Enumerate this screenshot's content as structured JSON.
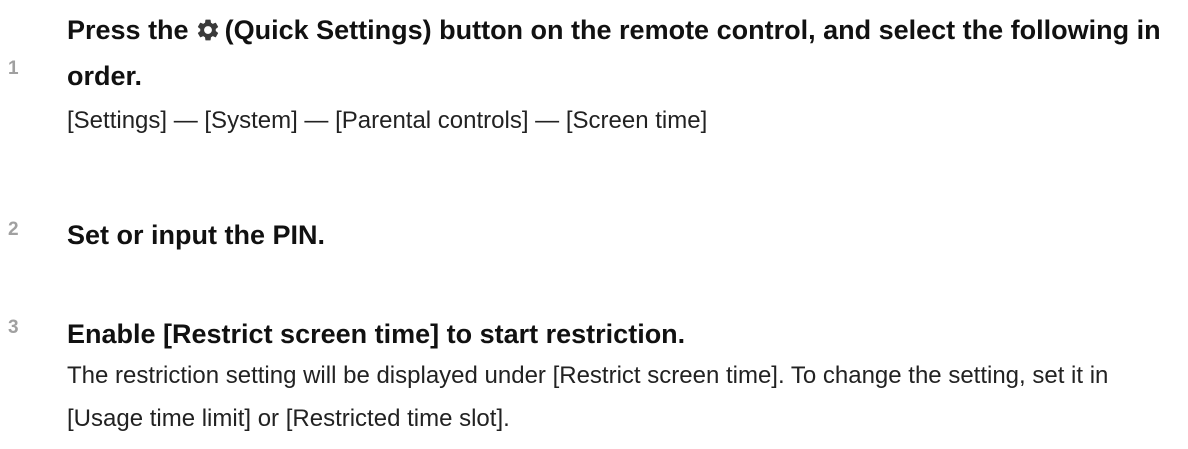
{
  "steps": [
    {
      "number": "1",
      "heading_before_icon": "Press the",
      "icon": "gear-icon",
      "heading_after_icon": "(Quick Settings) button on the remote control, and select the following in order.",
      "description": "[Settings] — [System] — [Parental controls] — [Screen time]"
    },
    {
      "number": "2",
      "heading": "Set or input the PIN."
    },
    {
      "number": "3",
      "heading": "Enable [Restrict screen time] to start restriction.",
      "description": "The restriction setting will be displayed under [Restrict screen time]. To change the setting, set it in [Usage time limit] or [Restricted time slot]."
    }
  ],
  "colors": {
    "step_number": "#a0a0a0",
    "heading": "#111111",
    "body_text": "#222222",
    "icon": "#3a3a3a"
  }
}
